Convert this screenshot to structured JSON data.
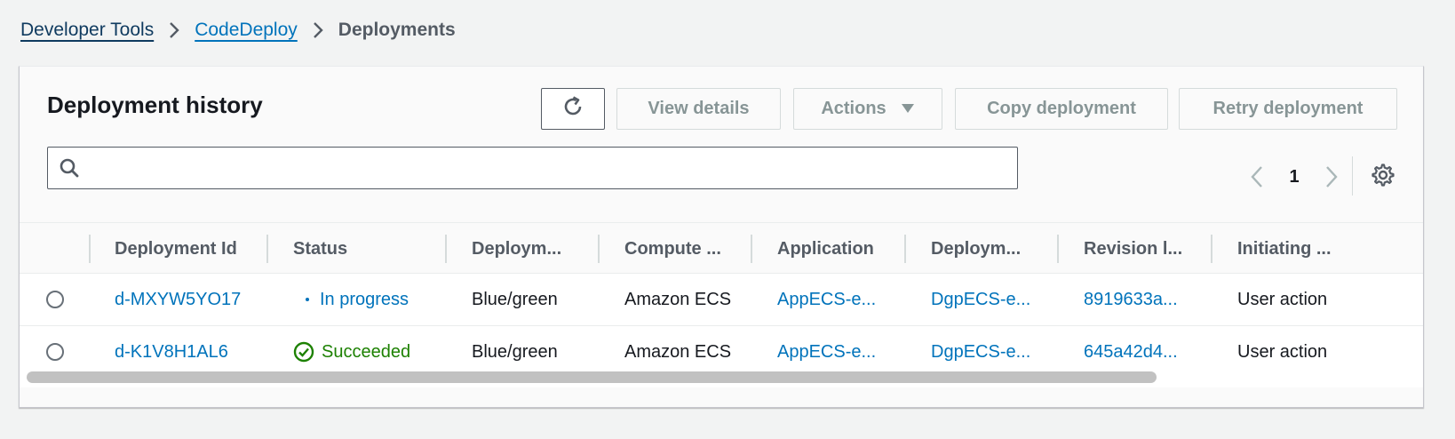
{
  "breadcrumb": {
    "items": [
      "Developer Tools",
      "CodeDeploy"
    ],
    "current": "Deployments"
  },
  "panel": {
    "title": "Deployment history",
    "buttons": {
      "refresh_icon": "refresh-icon",
      "view_details": "View details",
      "actions": "Actions",
      "copy_deployment": "Copy deployment",
      "retry_deployment": "Retry deployment"
    },
    "search": {
      "value": "",
      "placeholder": ""
    },
    "pager": {
      "page": "1"
    }
  },
  "table": {
    "columns": [
      "Deployment Id",
      "Status",
      "Deploym...",
      "Compute ...",
      "Application",
      "Deploym...",
      "Revision l...",
      "Initiating ..."
    ],
    "rows": [
      {
        "id": "d-MXYW5YO17",
        "status": "In progress",
        "type": "Blue/green",
        "compute": "Amazon ECS",
        "application": "AppECS-e...",
        "group": "DgpECS-e...",
        "revision": "8919633a...",
        "initiated": "User action"
      },
      {
        "id": "d-K1V8H1AL6",
        "status": "Succeeded",
        "type": "Blue/green",
        "compute": "Amazon ECS",
        "application": "AppECS-e...",
        "group": "DgpECS-e...",
        "revision": "645a42d4...",
        "initiated": "User action"
      }
    ]
  },
  "colors": {
    "link": "#0073bb",
    "success": "#1d8102",
    "disabled_text": "#879596"
  }
}
